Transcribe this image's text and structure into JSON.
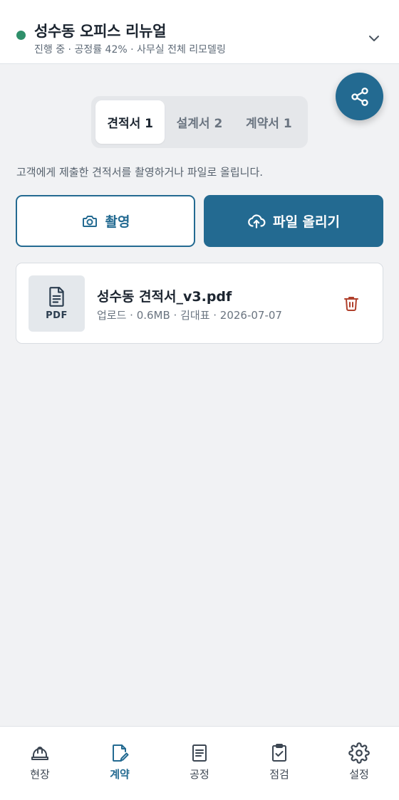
{
  "header": {
    "title": "성수동 오피스 리뉴얼",
    "subtitle": "진행 중 · 공정률 42% · 사무실 전체 리모델링",
    "status_color": "#2f8f6a",
    "toggle_icon": "chevron-down-icon"
  },
  "share": {
    "icon": "share-icon",
    "color": "#236a91"
  },
  "tabs": [
    {
      "label": "견적서 1",
      "active": true
    },
    {
      "label": "설계서 2",
      "active": false
    },
    {
      "label": "계약서 1",
      "active": false
    }
  ],
  "helper_text": "고객에게 제출한 견적서를 촬영하거나 파일로 올립니다.",
  "actions": {
    "capture_label": "촬영",
    "capture_icon": "camera-icon",
    "upload_label": "파일 올리기",
    "upload_icon": "cloud-upload-icon"
  },
  "file": {
    "thumb_label": "PDF",
    "name": "성수동 견적서_v3.pdf",
    "meta": "업로드 · 0.6MB · 김대표 · 2026-07-07",
    "delete_icon": "trash-icon"
  },
  "nav": [
    {
      "label": "현장",
      "icon": "hardhat-icon",
      "active": false
    },
    {
      "label": "계약",
      "icon": "document-edit-icon",
      "active": true
    },
    {
      "label": "공정",
      "icon": "list-document-icon",
      "active": false
    },
    {
      "label": "점검",
      "icon": "clipboard-check-icon",
      "active": false
    },
    {
      "label": "설정",
      "icon": "gear-icon",
      "active": false
    }
  ],
  "colors": {
    "accent": "#236a91",
    "danger": "#b0402c"
  }
}
